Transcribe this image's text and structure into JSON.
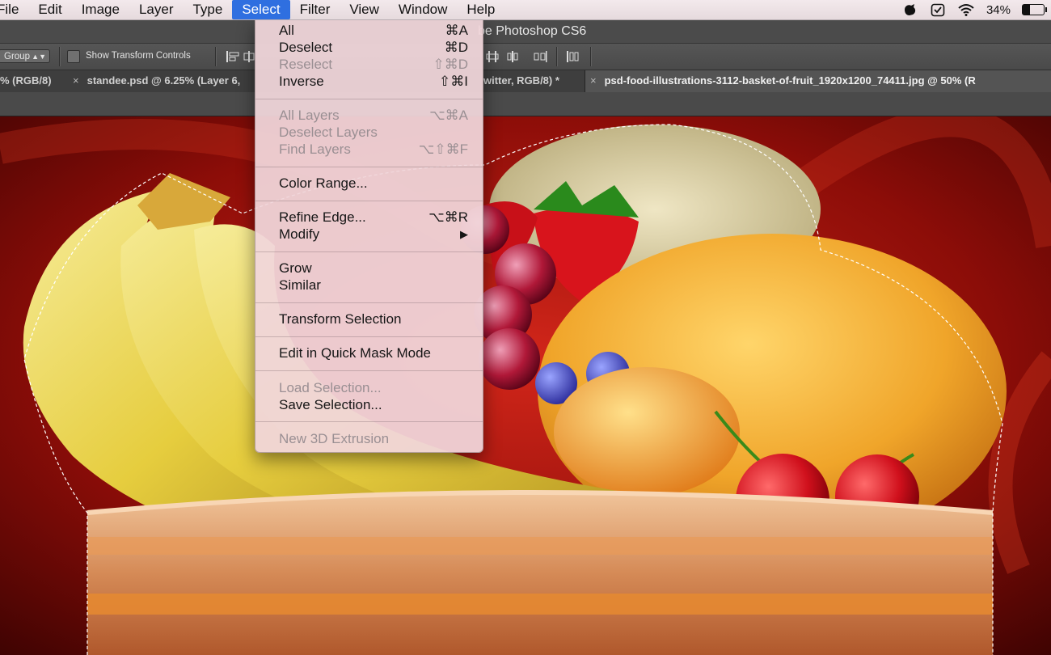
{
  "menubar": {
    "items": [
      "File",
      "Edit",
      "Image",
      "Layer",
      "Type",
      "Select",
      "Filter",
      "View",
      "Window",
      "Help"
    ],
    "active": "Select",
    "battery": "34%"
  },
  "app": {
    "title": "Adobe Photoshop CS6",
    "visible_title": "be Photoshop CS6"
  },
  "options_bar": {
    "group_select": "Group",
    "show_transform_label": "Show Transform Controls",
    "show_transform_checked": false
  },
  "tabs": [
    {
      "label": "% (RGB/8)",
      "close": ""
    },
    {
      "label": "standee.psd @ 6.25% (Layer 6,",
      "close": "×"
    },
    {
      "label": "witter, RGB/8) *",
      "close": ""
    },
    {
      "label": "psd-food-illustrations-3112-basket-of-fruit_1920x1200_74411.jpg @ 50% (R",
      "close": "×",
      "active": true
    }
  ],
  "select_menu": {
    "items": [
      {
        "label": "All",
        "shortcut": "⌘A",
        "enabled": true
      },
      {
        "label": "Deselect",
        "shortcut": "⌘D",
        "enabled": true
      },
      {
        "label": "Reselect",
        "shortcut": "⇧⌘D",
        "enabled": false
      },
      {
        "label": "Inverse",
        "shortcut": "⇧⌘I",
        "enabled": true
      },
      {
        "label": "All Layers",
        "shortcut": "⌥⌘A",
        "enabled": false
      },
      {
        "label": "Deselect Layers",
        "shortcut": "",
        "enabled": false
      },
      {
        "label": "Find Layers",
        "shortcut": "⌥⇧⌘F",
        "enabled": false
      },
      {
        "label": "Color Range...",
        "shortcut": "",
        "enabled": true
      },
      {
        "label": "Refine Edge...",
        "shortcut": "⌥⌘R",
        "enabled": true
      },
      {
        "label": "Modify",
        "shortcut": "▶",
        "enabled": true
      },
      {
        "label": "Grow",
        "shortcut": "",
        "enabled": true
      },
      {
        "label": "Similar",
        "shortcut": "",
        "enabled": true
      },
      {
        "label": "Transform Selection",
        "shortcut": "",
        "enabled": true
      },
      {
        "label": "Edit in Quick Mask Mode",
        "shortcut": "",
        "enabled": true
      },
      {
        "label": "Load Selection...",
        "shortcut": "",
        "enabled": false
      },
      {
        "label": "Save Selection...",
        "shortcut": "",
        "enabled": true
      },
      {
        "label": "New 3D Extrusion",
        "shortcut": "",
        "enabled": false
      }
    ]
  },
  "colors": {
    "menu_highlight": "#2f6fe0",
    "ps_panel": "#4b4b4b",
    "background_red": "#9b0f0a"
  }
}
